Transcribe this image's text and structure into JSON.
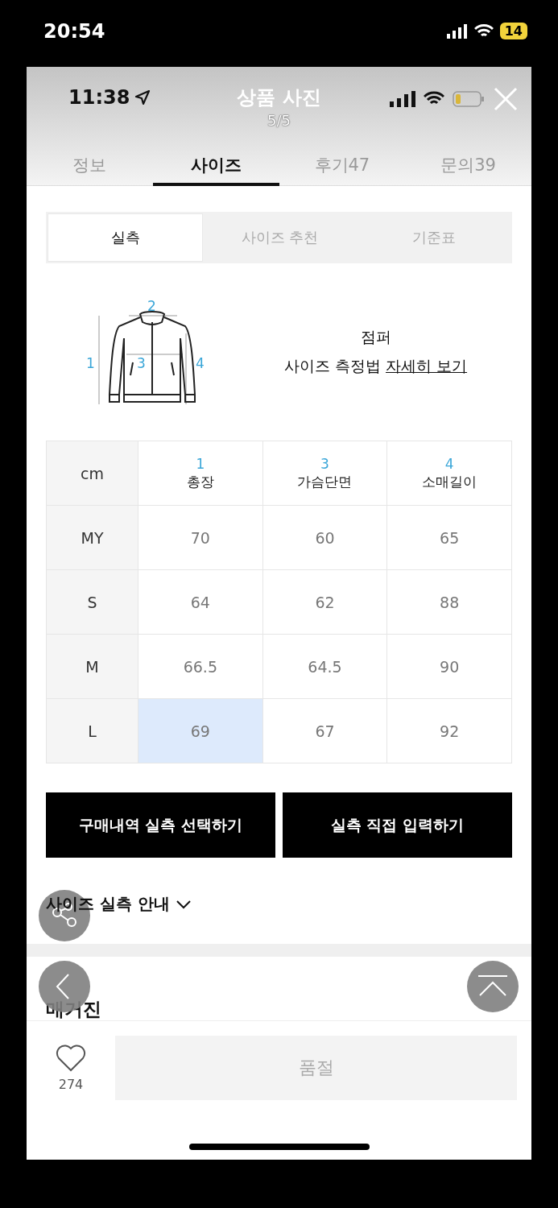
{
  "status_bar": {
    "time": "20:54",
    "battery": "14"
  },
  "viewer": {
    "time": "11:38",
    "title": "상품 사진",
    "counter": "5/5"
  },
  "tabs": [
    {
      "label": "정보",
      "selected": false
    },
    {
      "label": "사이즈",
      "selected": true
    },
    {
      "label": "후기47",
      "selected": false
    },
    {
      "label": "문의39",
      "selected": false
    }
  ],
  "segments": [
    {
      "label": "실측",
      "selected": true
    },
    {
      "label": "사이즈 추천",
      "selected": false
    },
    {
      "label": "기준표",
      "selected": false
    }
  ],
  "diagram": {
    "labels": [
      "1",
      "2",
      "3",
      "4"
    ]
  },
  "guide": {
    "product": "점퍼",
    "text": "사이즈 측정법",
    "link": "자세히 보기"
  },
  "table": {
    "unit": "cm",
    "columns": [
      {
        "number": "1",
        "label": "총장"
      },
      {
        "number": "3",
        "label": "가슴단면"
      },
      {
        "number": "4",
        "label": "소매길이"
      }
    ],
    "rows": [
      {
        "size": "MY",
        "cells": [
          {
            "value": "70",
            "selected": false
          },
          {
            "value": "60",
            "selected": false
          },
          {
            "value": "65",
            "selected": false
          }
        ]
      },
      {
        "size": "S",
        "cells": [
          {
            "value": "64",
            "selected": false
          },
          {
            "value": "62",
            "selected": false
          },
          {
            "value": "88",
            "selected": false
          }
        ]
      },
      {
        "size": "M",
        "cells": [
          {
            "value": "66.5",
            "selected": false
          },
          {
            "value": "64.5",
            "selected": false
          },
          {
            "value": "90",
            "selected": false
          }
        ]
      },
      {
        "size": "L",
        "cells": [
          {
            "value": "69",
            "selected": true
          },
          {
            "value": "67",
            "selected": false
          },
          {
            "value": "92",
            "selected": false
          }
        ]
      }
    ]
  },
  "buttons": [
    "구매내역 실측 선택하기",
    "실측 직접 입력하기"
  ],
  "expander": {
    "label": "사이즈 실측 안내",
    "expanded": false
  },
  "section_title": "매거진",
  "bottom_bar": {
    "likes": "274",
    "buy_button": {
      "label": "품절",
      "disabled": true
    }
  }
}
